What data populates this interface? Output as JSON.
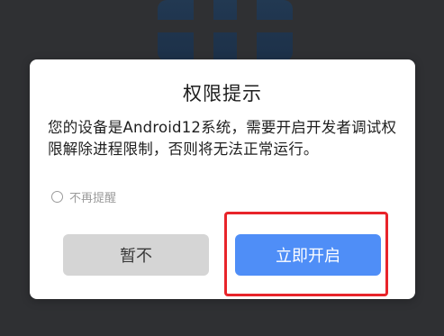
{
  "dialog": {
    "title": "权限提示",
    "message": "您的设备是Android12系统，需要开启开发者调试权限解除进程限制，否则将无法正常运行。",
    "checkbox_label": "不再提醒",
    "checkbox_checked": false,
    "cancel_label": "暂不",
    "confirm_label": "立即开启"
  },
  "colors": {
    "confirm_button": "#4f8ef7",
    "cancel_button": "#d5d5d5",
    "highlight_box": "#e8242a",
    "backdrop": "#2f3033"
  }
}
